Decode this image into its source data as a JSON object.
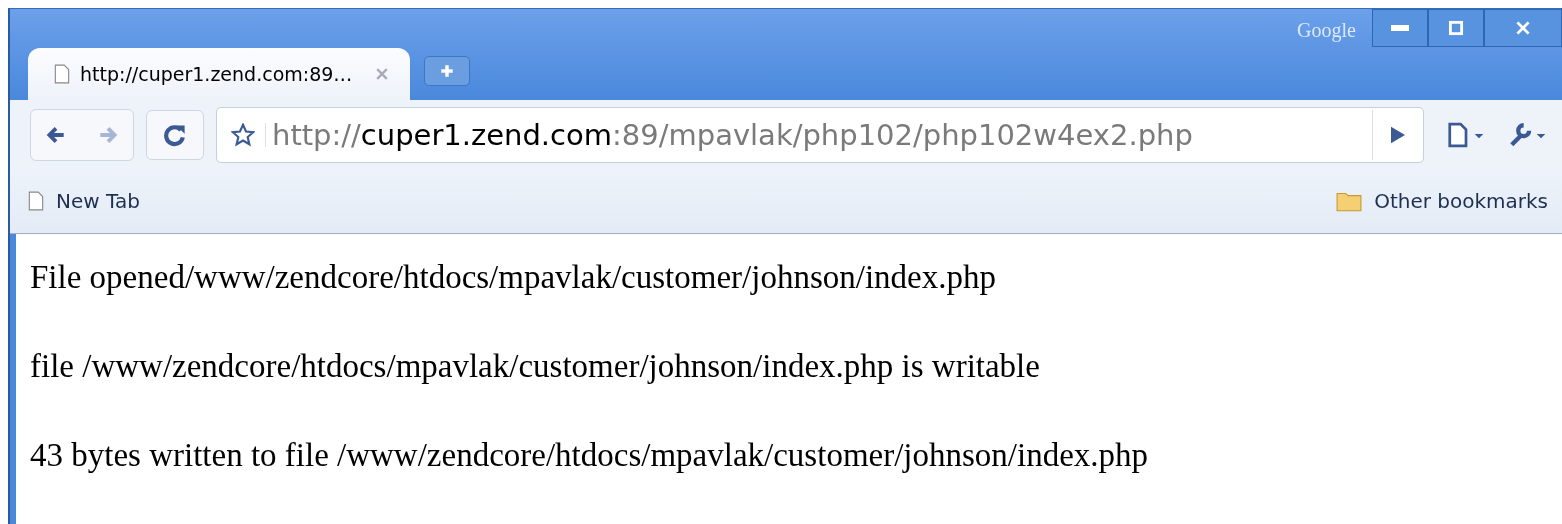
{
  "window": {
    "brand": "Google",
    "controls": [
      {
        "kind": "minimize"
      },
      {
        "kind": "maximize"
      },
      {
        "kind": "close"
      }
    ]
  },
  "tabs": [
    {
      "title": "http://cuper1.zend.com:89…",
      "selected": true
    }
  ],
  "address_bar": {
    "scheme": "http://",
    "host": "cuper1.zend.com",
    "rest": ":89/mpavlak/php102/php102w4ex2.php"
  },
  "bookmarks": {
    "items": [
      {
        "label": "New Tab",
        "kind": "page"
      }
    ],
    "other": "Other bookmarks"
  },
  "content": {
    "lines": [
      "File opened/www/zendcore/htdocs/mpavlak/customer/johnson/index.php",
      "file /www/zendcore/htdocs/mpavlak/customer/johnson/index.php is writable",
      "43 bytes written to file /www/zendcore/htdocs/mpavlak/customer/johnson/index.php"
    ]
  }
}
